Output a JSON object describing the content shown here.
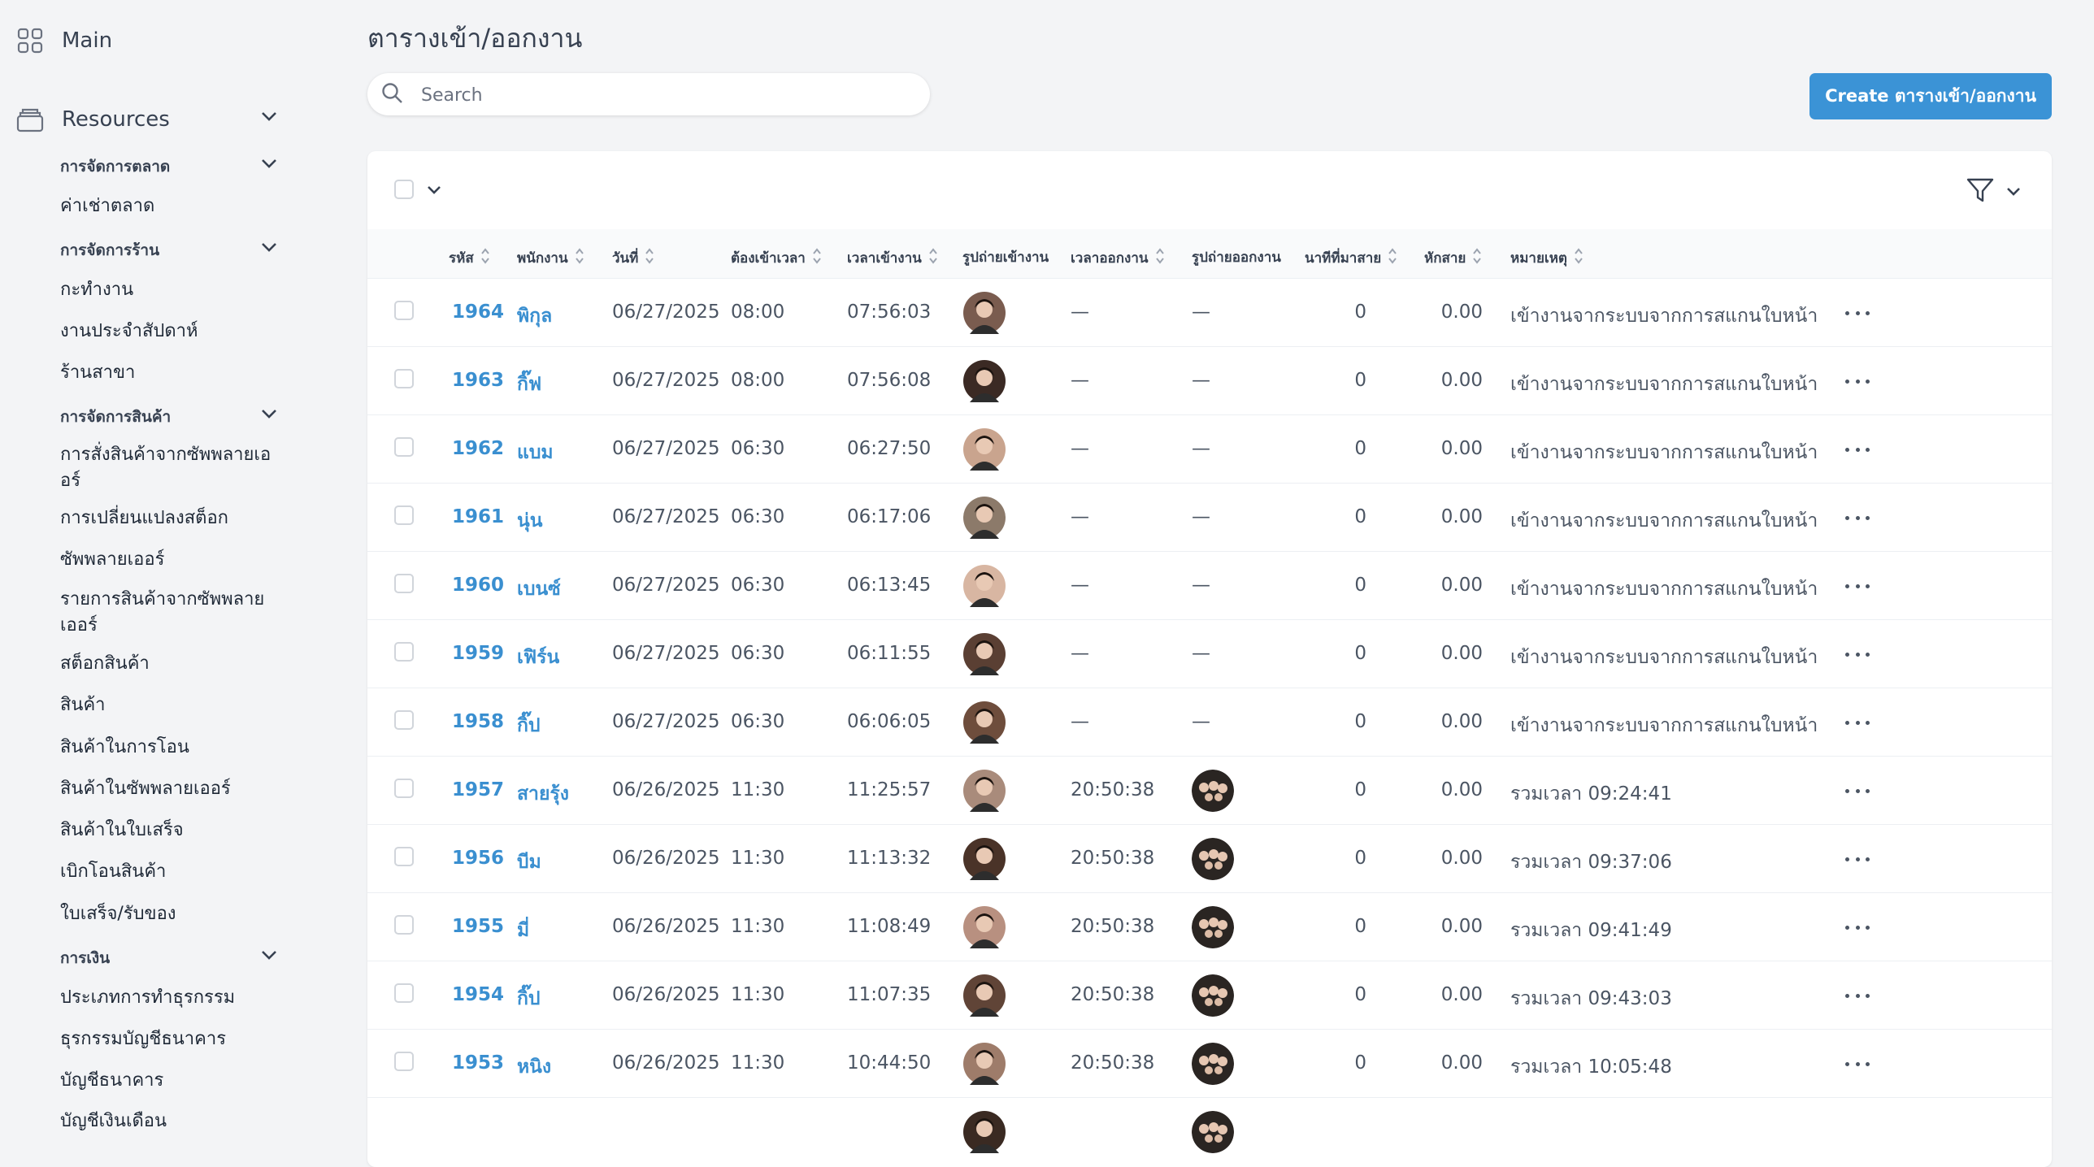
{
  "sidebar": {
    "main_label": "Main",
    "resources_label": "Resources",
    "groups": {
      "market": "การจัดการตลาด",
      "shop": "การจัดการร้าน",
      "product": "การจัดการสินค้า",
      "finance": "การเงิน"
    },
    "items": {
      "market_rent": "ค่าเช่าตลาด",
      "shift": "กะทำงาน",
      "weekly_work": "งานประจำสัปดาห์",
      "branch": "ร้านสาขา",
      "supplier_orders": "การสั่งสินค้าจากซัพพลายเออร์",
      "stock_changes": "การเปลี่ยนแปลงสต็อก",
      "suppliers": "ซัพพลายเออร์",
      "supplier_products": "รายการสินค้าจากซัพพลายเออร์",
      "stock": "สต็อกสินค้า",
      "products": "สินค้า",
      "transfer_products": "สินค้าในการโอน",
      "supplier_items": "สินค้าในซัพพลายเออร์",
      "receipt_products": "สินค้าในใบเสร็จ",
      "withdraw_transfer": "เบิกโอนสินค้า",
      "receipts": "ใบเสร็จ/รับของ",
      "tx_types": "ประเภทการทำธุรกรรม",
      "bank_tx": "ธุรกรรมบัญชีธนาคาร",
      "bank_accounts": "บัญชีธนาคาร",
      "cutoff": "บัญชีเงินเดือน"
    }
  },
  "header": {
    "title": "ตารางเข้า/ออกงาน",
    "search_placeholder": "Search",
    "create_label": "Create ตารางเข้า/ออกงาน"
  },
  "table": {
    "headers": {
      "id": "รหัส",
      "employee": "พนักงาน",
      "date": "วันที่",
      "required": "ต้องเข้าเวลา",
      "checkin": "เวลาเข้างาน",
      "checkin_photo": "รูปถ่ายเข้างาน",
      "checkout": "เวลาออกงาน",
      "checkout_photo": "รูปถ่ายออกงาน",
      "late_min": "นาทีที่มาสาย",
      "deduct": "หักสาย",
      "note": "หมายเหตุ"
    },
    "rows": [
      {
        "id": "1964",
        "name": "พิกุล",
        "date": "06/27/2025",
        "req": "08:00",
        "in": "07:56:03",
        "out": "—",
        "out_photo": false,
        "late": "0",
        "deduct": "0.00",
        "note": "เข้างานจากระบบจากการสแกนใบหน้า"
      },
      {
        "id": "1963",
        "name": "กิ๊ฟ",
        "date": "06/27/2025",
        "req": "08:00",
        "in": "07:56:08",
        "out": "—",
        "out_photo": false,
        "late": "0",
        "deduct": "0.00",
        "note": "เข้างานจากระบบจากการสแกนใบหน้า"
      },
      {
        "id": "1962",
        "name": "แบม",
        "date": "06/27/2025",
        "req": "06:30",
        "in": "06:27:50",
        "out": "—",
        "out_photo": false,
        "late": "0",
        "deduct": "0.00",
        "note": "เข้างานจากระบบจากการสแกนใบหน้า"
      },
      {
        "id": "1961",
        "name": "นุ่น",
        "date": "06/27/2025",
        "req": "06:30",
        "in": "06:17:06",
        "out": "—",
        "out_photo": false,
        "late": "0",
        "deduct": "0.00",
        "note": "เข้างานจากระบบจากการสแกนใบหน้า"
      },
      {
        "id": "1960",
        "name": "เบนซ์",
        "date": "06/27/2025",
        "req": "06:30",
        "in": "06:13:45",
        "out": "—",
        "out_photo": false,
        "late": "0",
        "deduct": "0.00",
        "note": "เข้างานจากระบบจากการสแกนใบหน้า"
      },
      {
        "id": "1959",
        "name": "เฟิร์น",
        "date": "06/27/2025",
        "req": "06:30",
        "in": "06:11:55",
        "out": "—",
        "out_photo": false,
        "late": "0",
        "deduct": "0.00",
        "note": "เข้างานจากระบบจากการสแกนใบหน้า"
      },
      {
        "id": "1958",
        "name": "กิ๊ป",
        "date": "06/27/2025",
        "req": "06:30",
        "in": "06:06:05",
        "out": "—",
        "out_photo": false,
        "late": "0",
        "deduct": "0.00",
        "note": "เข้างานจากระบบจากการสแกนใบหน้า"
      },
      {
        "id": "1957",
        "name": "สายรุ้ง",
        "date": "06/26/2025",
        "req": "11:30",
        "in": "11:25:57",
        "out": "20:50:38",
        "out_photo": true,
        "late": "0",
        "deduct": "0.00",
        "note": "รวมเวลา 09:24:41"
      },
      {
        "id": "1956",
        "name": "บีม",
        "date": "06/26/2025",
        "req": "11:30",
        "in": "11:13:32",
        "out": "20:50:38",
        "out_photo": true,
        "late": "0",
        "deduct": "0.00",
        "note": "รวมเวลา 09:37:06"
      },
      {
        "id": "1955",
        "name": "มี่",
        "date": "06/26/2025",
        "req": "11:30",
        "in": "11:08:49",
        "out": "20:50:38",
        "out_photo": true,
        "late": "0",
        "deduct": "0.00",
        "note": "รวมเวลา 09:41:49"
      },
      {
        "id": "1954",
        "name": "กิ๊ป",
        "date": "06/26/2025",
        "req": "11:30",
        "in": "11:07:35",
        "out": "20:50:38",
        "out_photo": true,
        "late": "0",
        "deduct": "0.00",
        "note": "รวมเวลา 09:43:03"
      },
      {
        "id": "1953",
        "name": "หนิง",
        "date": "06/26/2025",
        "req": "11:30",
        "in": "10:44:50",
        "out": "20:50:38",
        "out_photo": true,
        "late": "0",
        "deduct": "0.00",
        "note": "รวมเวลา 10:05:48"
      }
    ],
    "partial_row_out_photo": true
  },
  "colors": {
    "accent": "#3b93d6",
    "link": "#3a8fd0"
  }
}
